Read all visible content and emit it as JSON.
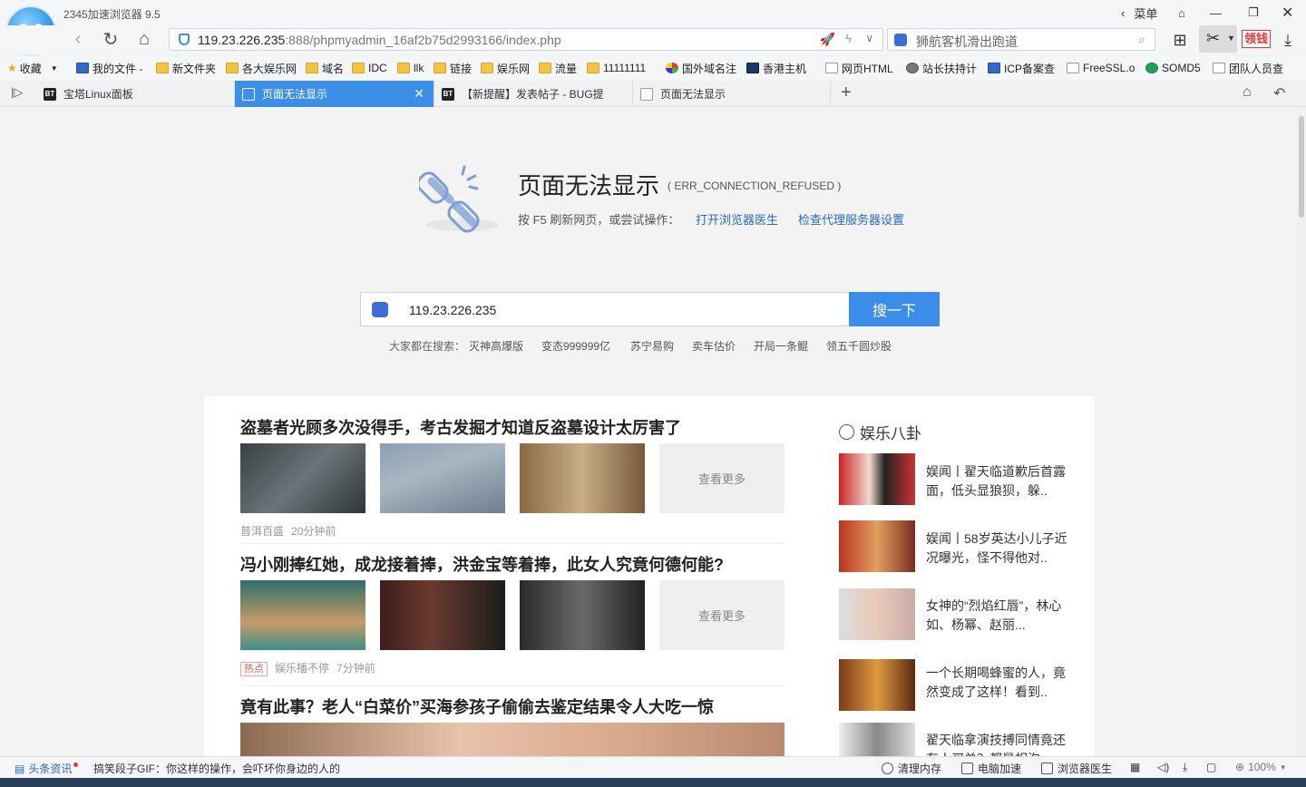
{
  "app": {
    "title": "2345加速浏览器 9.5"
  },
  "window": {
    "menu": "菜单"
  },
  "nav": {
    "url_main": "119.23.226.235",
    "url_rest": ":888/phpmyadmin_16af2b75d2993166/index.php",
    "search_placeholder": "狮航客机滑出跑道"
  },
  "toolbar": {
    "lingqian": "领钱"
  },
  "bookmarks": [
    {
      "label": "收藏"
    },
    {
      "label": "我的文件 -"
    },
    {
      "label": "新文件夹"
    },
    {
      "label": "各大娱乐网"
    },
    {
      "label": "域名"
    },
    {
      "label": "IDC"
    },
    {
      "label": "llk"
    },
    {
      "label": "链接"
    },
    {
      "label": "娱乐网"
    },
    {
      "label": "流量"
    },
    {
      "label": "11111111"
    },
    {
      "label": "国外域名注"
    },
    {
      "label": "香港主机"
    },
    {
      "label": "网页HTML"
    },
    {
      "label": "站长扶持计"
    },
    {
      "label": "ICP备案查"
    },
    {
      "label": "FreeSSL.o"
    },
    {
      "label": "SOMD5"
    },
    {
      "label": "团队人员查"
    }
  ],
  "tabs": [
    {
      "label": "宝塔Linux面板",
      "fav": "BT"
    },
    {
      "label": "页面无法显示",
      "fav": ""
    },
    {
      "label": "【新提醒】发表帖子 - BUG提",
      "fav": "BT"
    },
    {
      "label": "页面无法显示",
      "fav": ""
    }
  ],
  "error": {
    "title": "页面无法显示",
    "code": "( ERR_CONNECTION_REFUSED )",
    "hint": "按 F5 刷新网页，或尝试操作：",
    "link1": "打开浏览器医生",
    "link2": "检查代理服务器设置"
  },
  "search": {
    "value": "119.23.226.235",
    "button": "搜一下",
    "hot_label": "大家都在搜索：",
    "hot": [
      "灭神高爆版",
      "变态999999亿",
      "苏宁易购",
      "卖车估价",
      "开局一条鲲",
      "领五千圆炒股"
    ]
  },
  "news": [
    {
      "title": "盗墓者光顾多次没得手，考古发掘才知道反盗墓设计太厉害了",
      "more": "查看更多",
      "source": "普洱百盛",
      "time": "20分钟前",
      "badge": ""
    },
    {
      "title": "冯小刚捧红她，成龙接着捧，洪金宝等着捧，此女人究竟何德何能?",
      "more": "查看更多",
      "source": "娱乐播不停",
      "time": "7分钟前",
      "badge": "热点"
    },
    {
      "title": "竟有此事？老人“白菜价”买海参孩子偷偷去鉴定结果令人大吃一惊",
      "more": "",
      "source": "",
      "time": "",
      "badge": ""
    }
  ],
  "side": {
    "heading": "娱乐八卦",
    "items": [
      {
        "text": "娱闻丨翟天临道歉后首露面，低头显狼狈，躲.."
      },
      {
        "text": "娱闻丨58岁英达小儿子近况曝光，怪不得他对.."
      },
      {
        "text": "女神的“烈焰红唇”，林心如、杨幂、赵丽..."
      },
      {
        "text": "一个长期喝蜂蜜的人，竟然变成了这样！看到.."
      },
      {
        "text": "翟天临拿演技搏同情竟还有人买单？都是相沟.."
      }
    ]
  },
  "status": {
    "news_label": "头条资讯",
    "news_text": "搞笑段子GIF：你这样的操作，会吓坏你身边的人的",
    "clean": "清理内存",
    "speed": "电脑加速",
    "doctor": "浏览器医生",
    "zoom": "100%"
  },
  "colors": {
    "accent": "#3c8fe6",
    "link": "#2a68c8",
    "red": "#e53935"
  }
}
